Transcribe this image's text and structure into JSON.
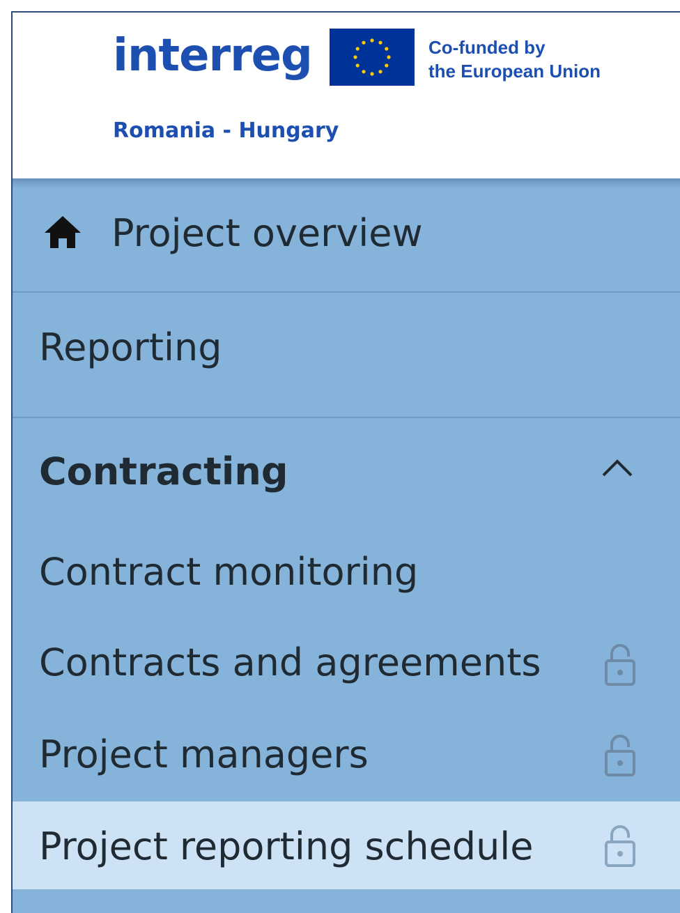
{
  "header": {
    "logo_text": "interreg",
    "cofunded_line1": "Co-funded by",
    "cofunded_line2": "the European Union",
    "region": "Romania - Hungary"
  },
  "nav": {
    "overview": {
      "label": "Project overview",
      "icon": "home-icon"
    },
    "reporting": {
      "label": "Reporting"
    },
    "contracting": {
      "label": "Contracting",
      "expanded": true,
      "icon": "chevron-up-icon",
      "items": [
        {
          "label": "Contract monitoring",
          "locked": false
        },
        {
          "label": "Contracts and agreements",
          "locked": true,
          "icon": "lock-icon"
        },
        {
          "label": "Project managers",
          "locked": true,
          "icon": "lock-icon"
        },
        {
          "label": "Project reporting schedule",
          "locked": true,
          "icon": "lock-icon",
          "active": true
        }
      ]
    }
  },
  "colors": {
    "brand_blue": "#1c4fb0",
    "eu_blue": "#003399",
    "eu_star": "#ffcc00",
    "nav_bg": "#86b3da",
    "active_bg": "#cde3f5"
  }
}
